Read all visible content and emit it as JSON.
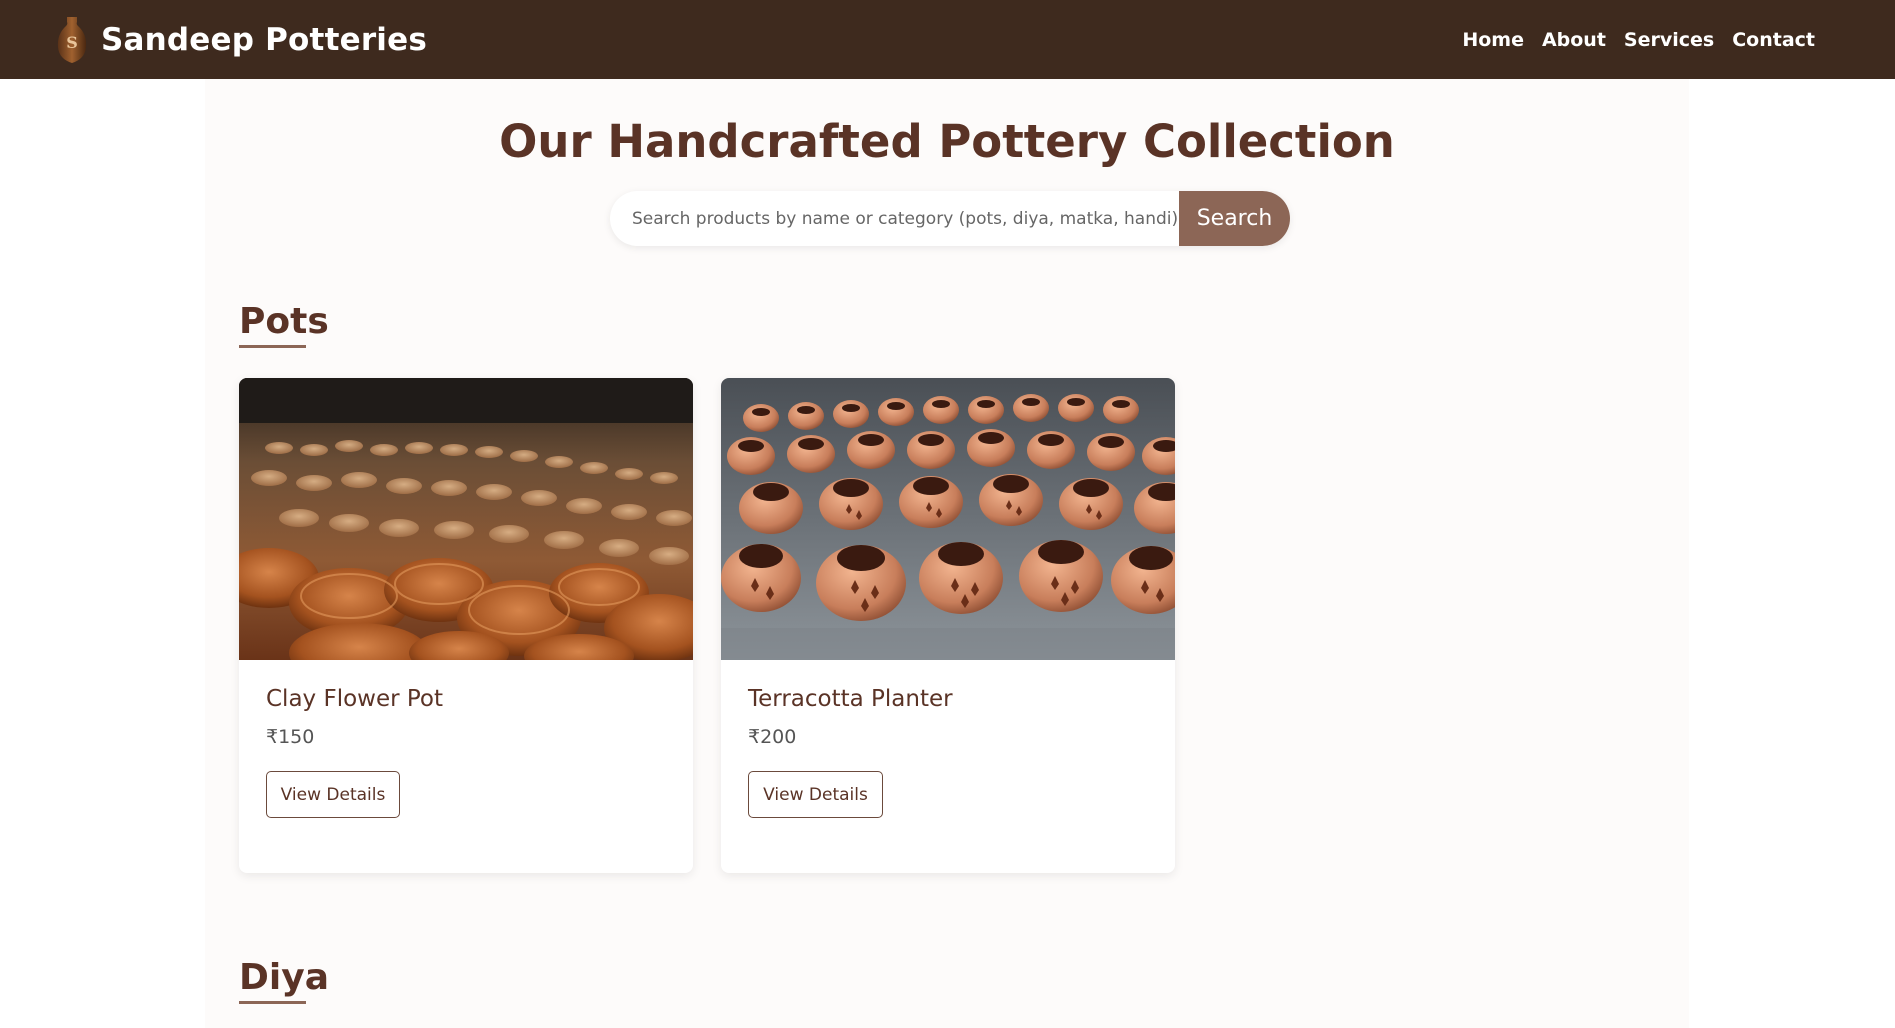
{
  "header": {
    "brand_name": "Sandeep Potteries",
    "logo_letter": "S",
    "nav": [
      {
        "label": "Home"
      },
      {
        "label": "About"
      },
      {
        "label": "Services"
      },
      {
        "label": "Contact"
      }
    ]
  },
  "main": {
    "title": "Our Handcrafted Pottery Collection",
    "search": {
      "placeholder": "Search products by name or category (pots, diya, matka, handi)...",
      "value": "",
      "button_label": "Search"
    },
    "sections": [
      {
        "title": "Pots",
        "products": [
          {
            "name": "Clay Flower Pot",
            "price": "₹150",
            "button_label": "View Details",
            "image_icon": "pottery-bowls-photo"
          },
          {
            "name": "Terracotta Planter",
            "price": "₹200",
            "button_label": "View Details",
            "image_icon": "terracotta-lanterns-photo"
          }
        ]
      },
      {
        "title": "Diya",
        "products": []
      }
    ]
  },
  "colors": {
    "header_bg": "#3e2a1e",
    "accent": "#8c6656",
    "title": "#5a3326",
    "page_bg": "#fdfbfa"
  }
}
